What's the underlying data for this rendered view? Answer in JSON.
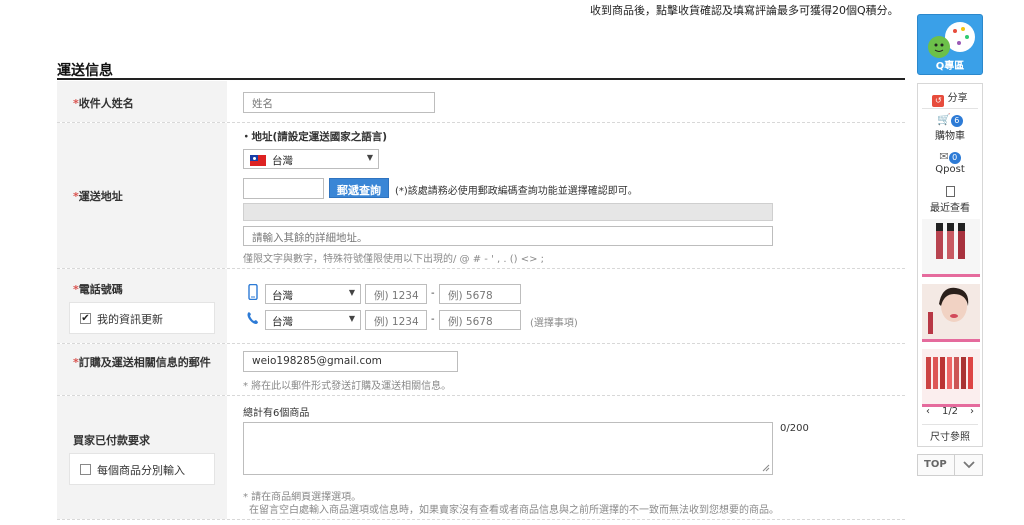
{
  "top_notice": "收到商品後，點擊收貨確認及填寫評論最多可獲得20個Q積分。",
  "section_title": "運送信息",
  "recipient": {
    "label": "收件人姓名",
    "placeholder": "姓名"
  },
  "address": {
    "label": "運送地址",
    "heading": "・地址(請設定運送國家之語言)",
    "country": "台灣",
    "postal_button": "郵遞查詢",
    "postal_note": "(*)該處請務必使用郵政編碼查詢功能並選擇確認即可。",
    "detail_placeholder": "請輸入其餘的詳細地址。",
    "detail_note": "僅限文字與數字，特殊符號僅限使用以下出現的/ @ # - ' , . () <> ;"
  },
  "phone": {
    "label": "電話號碼",
    "update_checkbox_label": "我的資訊更新",
    "update_checked": true,
    "rows": [
      {
        "icon": "mobile-phone-icon",
        "country": "台灣",
        "part1_placeholder": "例) 1234",
        "part2_placeholder": "例) 5678",
        "optional": ""
      },
      {
        "icon": "telephone-icon",
        "country": "台灣",
        "part1_placeholder": "例) 1234",
        "part2_placeholder": "例) 5678",
        "optional": "(選擇事項)"
      }
    ],
    "dash": "-"
  },
  "email": {
    "label": "訂購及運送相關信息的郵件",
    "value": "weio198285@gmail.com",
    "note": "* 將在此以郵件形式發送訂購及運送相關信息。"
  },
  "buyer_request": {
    "label": "買家已付款要求",
    "product_count": "總計有6個商品",
    "char_count": "0/200",
    "per_item_checkbox_label": "每個商品分別輸入",
    "per_item_checked": false,
    "note_line1": "* 請在商品網頁選擇選項。",
    "note_line2": "在留言空白處輸入商品選項或信息時，如果賣家沒有查看或者商品信息與之前所選擇的不一致而無法收到您想要的商品。"
  },
  "side": {
    "qzone_label": "Q專區",
    "share": "分享",
    "cart_label": "購物車",
    "cart_count": "6",
    "qpost_label": "Qpost",
    "qpost_count": "0",
    "recent_label": "最近查看",
    "page": "1/2",
    "prev": "‹",
    "next": "›",
    "size_guide": "尺寸參照",
    "top_label": "TOP"
  },
  "colors": {
    "accent_blue": "#3a86d6",
    "required_red": "#d9534f",
    "label_bg": "#f3f3f3"
  }
}
